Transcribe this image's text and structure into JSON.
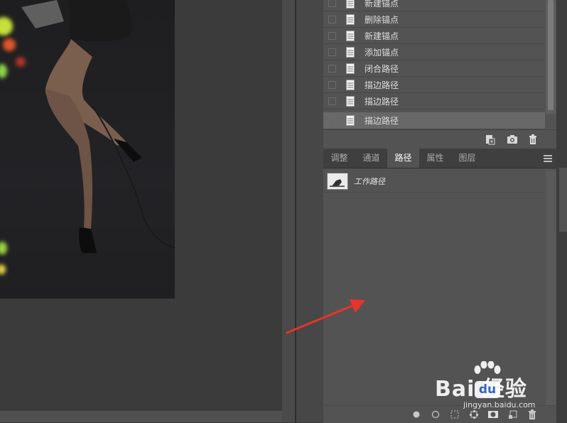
{
  "history": {
    "items": [
      {
        "label": "新建锚点",
        "selected": false
      },
      {
        "label": "删除锚点",
        "selected": false
      },
      {
        "label": "新建锚点",
        "selected": false
      },
      {
        "label": "添加锚点",
        "selected": false
      },
      {
        "label": "闭合路径",
        "selected": false
      },
      {
        "label": "描边路径",
        "selected": false
      },
      {
        "label": "描边路径",
        "selected": false
      },
      {
        "label": "描边路径",
        "selected": true
      }
    ],
    "toolbar_icons": [
      "new-document-from-state-icon",
      "camera-snapshot-icon",
      "trash-icon"
    ]
  },
  "panel_tabs": [
    {
      "label": "调整",
      "active": false
    },
    {
      "label": "通道",
      "active": false
    },
    {
      "label": "路径",
      "active": true
    },
    {
      "label": "属性",
      "active": false
    },
    {
      "label": "图层",
      "active": false
    }
  ],
  "paths": {
    "items": [
      {
        "label": "工作路径"
      }
    ],
    "toolbar_icons": [
      "fill-path-icon",
      "stroke-path-icon",
      "load-as-selection-icon",
      "make-work-path-icon",
      "add-mask-icon",
      "new-path-icon",
      "delete-path-icon"
    ]
  },
  "watermark": {
    "title": "Bai 经验",
    "brand_mark": "du",
    "subtitle": "jingyan.baidu.com"
  },
  "annotation": {
    "color": "#e8332a",
    "icon": "red-arrow-annotation"
  }
}
